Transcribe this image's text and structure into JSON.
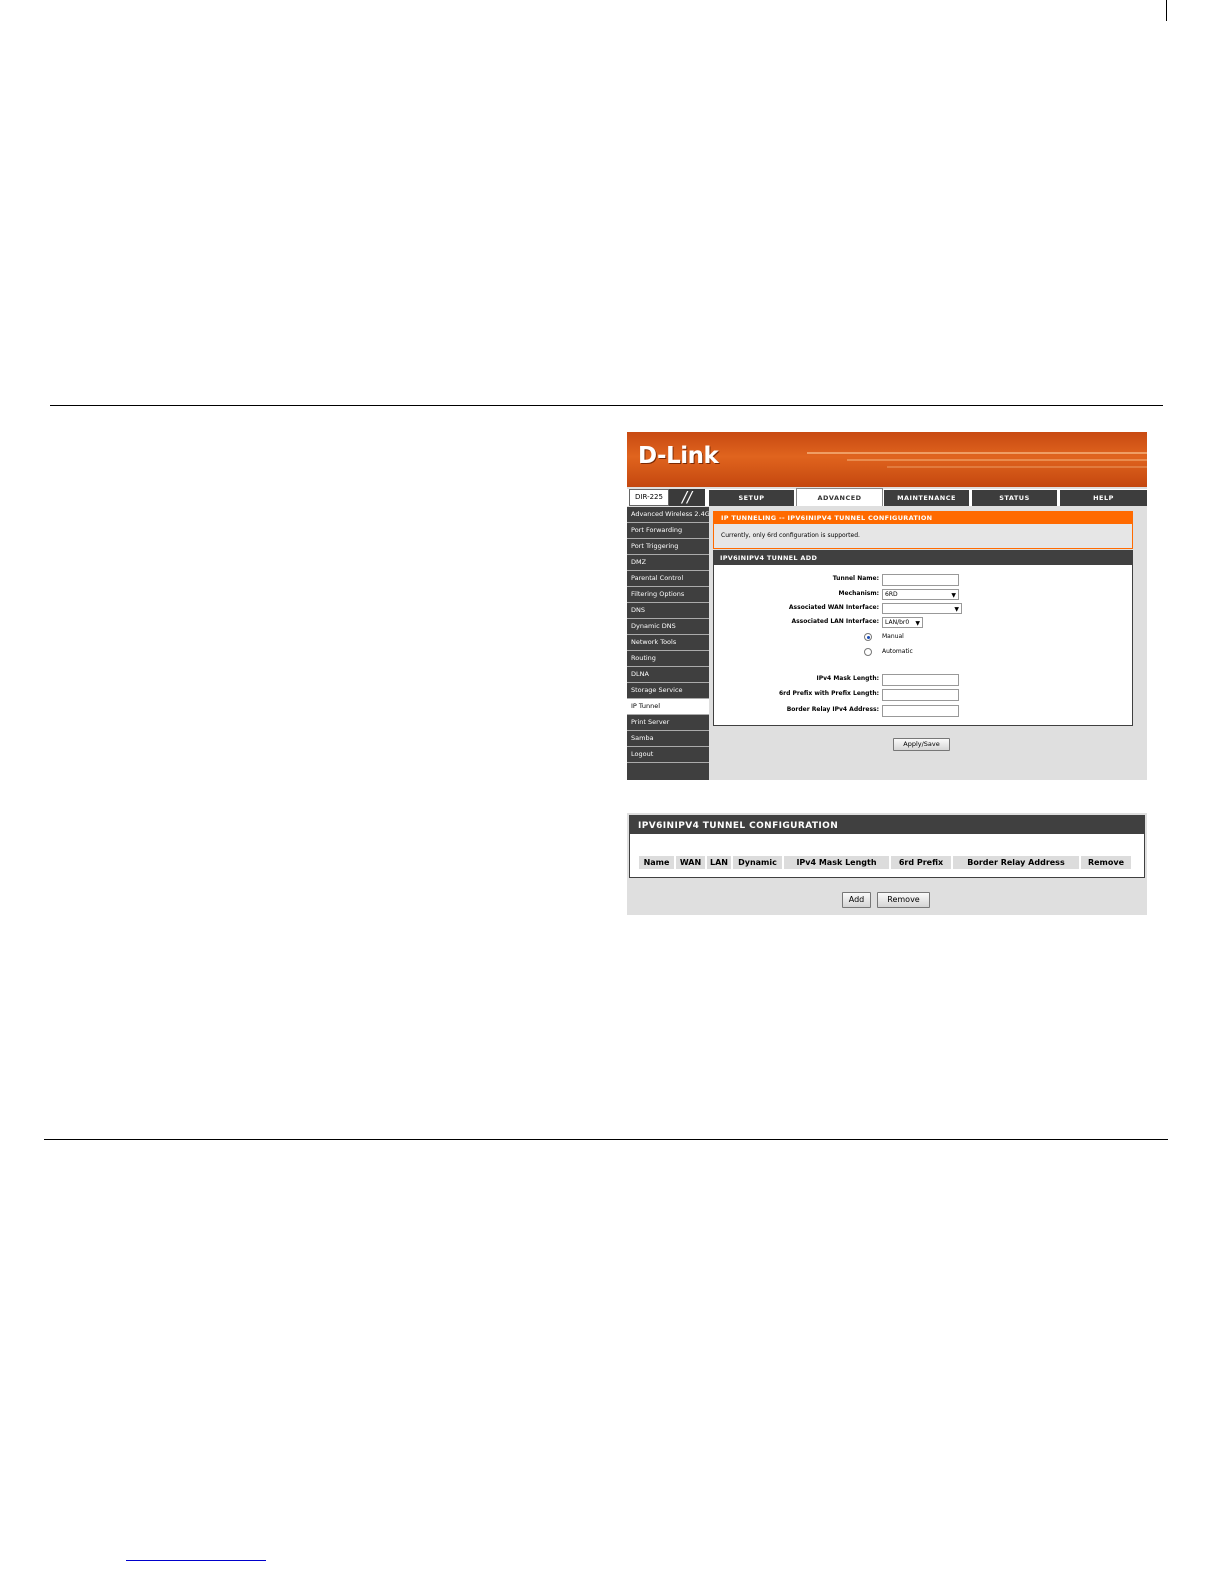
{
  "router": {
    "brand": "D-Link",
    "model": "DIR-225",
    "tabs": [
      "SETUP",
      "ADVANCED",
      "MAINTENANCE",
      "STATUS",
      "HELP"
    ],
    "active_tab": "ADVANCED",
    "sidebar": [
      "Advanced Wireless 2.4G",
      "Port Forwarding",
      "Port Triggering",
      "DMZ",
      "Parental Control",
      "Filtering Options",
      "DNS",
      "Dynamic DNS",
      "Network Tools",
      "Routing",
      "DLNA",
      "Storage Service",
      "IP Tunnel",
      "Print Server",
      "Samba",
      "Logout"
    ],
    "active_sidebar": "IP Tunnel",
    "section1": {
      "title": "IP TUNNELING -- IPV6INIPV4 TUNNEL CONFIGURATION",
      "message": "Currently, only 6rd configuration is supported."
    },
    "section2": {
      "title": "IPV6INIPV4 TUNNEL ADD",
      "labels": {
        "tunnel_name": "Tunnel Name:",
        "mechanism": "Mechanism:",
        "wan": "Associated WAN Interface:",
        "lan": "Associated LAN Interface:",
        "mask": "IPv4 Mask Length:",
        "prefix": "6rd Prefix with Prefix Length:",
        "border": "Border Relay IPv4 Address:"
      },
      "values": {
        "tunnel_name": "",
        "mechanism": "6RD",
        "wan": "",
        "lan": "LAN/br0",
        "mask": "",
        "prefix": "",
        "border": ""
      },
      "radio": {
        "manual": "Manual",
        "automatic": "Automatic",
        "selected": "Manual"
      }
    },
    "apply_label": "Apply/Save"
  },
  "config_table": {
    "title": "IPV6INIPV4 TUNNEL CONFIGURATION",
    "columns": [
      "Name",
      "WAN",
      "LAN",
      "Dynamic",
      "IPv4 Mask Length",
      "6rd Prefix",
      "Border Relay Address",
      "Remove"
    ],
    "rows": [],
    "add_label": "Add",
    "remove_label": "Remove"
  }
}
